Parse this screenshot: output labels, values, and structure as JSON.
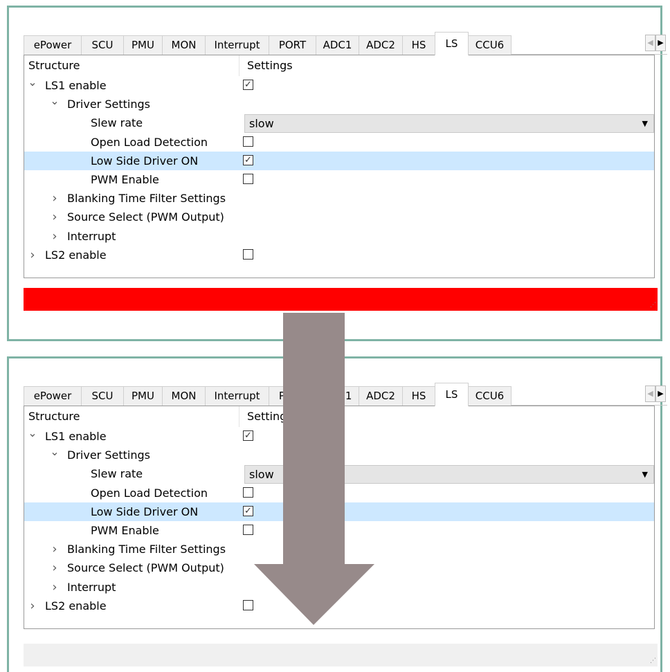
{
  "tabs": [
    {
      "label": "ePower",
      "name": "tab-epower"
    },
    {
      "label": "SCU",
      "name": "tab-scu"
    },
    {
      "label": "PMU",
      "name": "tab-pmu"
    },
    {
      "label": "MON",
      "name": "tab-mon"
    },
    {
      "label": "Interrupt",
      "name": "tab-interrupt"
    },
    {
      "label": "PORT",
      "name": "tab-port"
    },
    {
      "label": "ADC1",
      "name": "tab-adc1"
    },
    {
      "label": "ADC2",
      "name": "tab-adc2"
    },
    {
      "label": "HS",
      "name": "tab-hs"
    },
    {
      "label": "LS",
      "name": "tab-ls"
    },
    {
      "label": "CCU6",
      "name": "tab-ccu6"
    }
  ],
  "active_tab": "LS",
  "tree": {
    "col_structure": "Structure",
    "col_settings": "Settings",
    "rows": [
      {
        "label": "LS1 enable",
        "caret": "expanded",
        "level": 0,
        "control": "checkbox",
        "checked": true
      },
      {
        "label": "Driver Settings",
        "caret": "expanded",
        "level": 1,
        "control": "none"
      },
      {
        "label": "Slew rate",
        "caret": "none",
        "level": 2,
        "control": "combo",
        "value": "slow"
      },
      {
        "label": "Open Load Detection",
        "caret": "none",
        "level": 2,
        "control": "checkbox",
        "checked": false
      },
      {
        "label": "Low Side Driver ON",
        "caret": "none",
        "level": 2,
        "control": "checkbox",
        "checked": true,
        "selected": true
      },
      {
        "label": "PWM Enable",
        "caret": "none",
        "level": 2,
        "control": "checkbox",
        "checked": false
      },
      {
        "label": "Blanking Time Filter Settings",
        "caret": "collapsed",
        "level": 1,
        "control": "none"
      },
      {
        "label": "Source Select (PWM Output)",
        "caret": "collapsed",
        "level": 1,
        "control": "none"
      },
      {
        "label": "Interrupt",
        "caret": "collapsed",
        "level": 1,
        "control": "none"
      },
      {
        "label": "LS2 enable",
        "caret": "collapsed",
        "level": 0,
        "control": "checkbox",
        "checked": false
      }
    ]
  },
  "status_colors": {
    "top": "#ff0000",
    "bottom": "#f0f0f0"
  },
  "arrow_color": "#978a8a",
  "icons": {
    "expanded": "chevron-down-icon",
    "collapsed": "chevron-right-icon",
    "combo": "dropdown-arrow-icon"
  }
}
